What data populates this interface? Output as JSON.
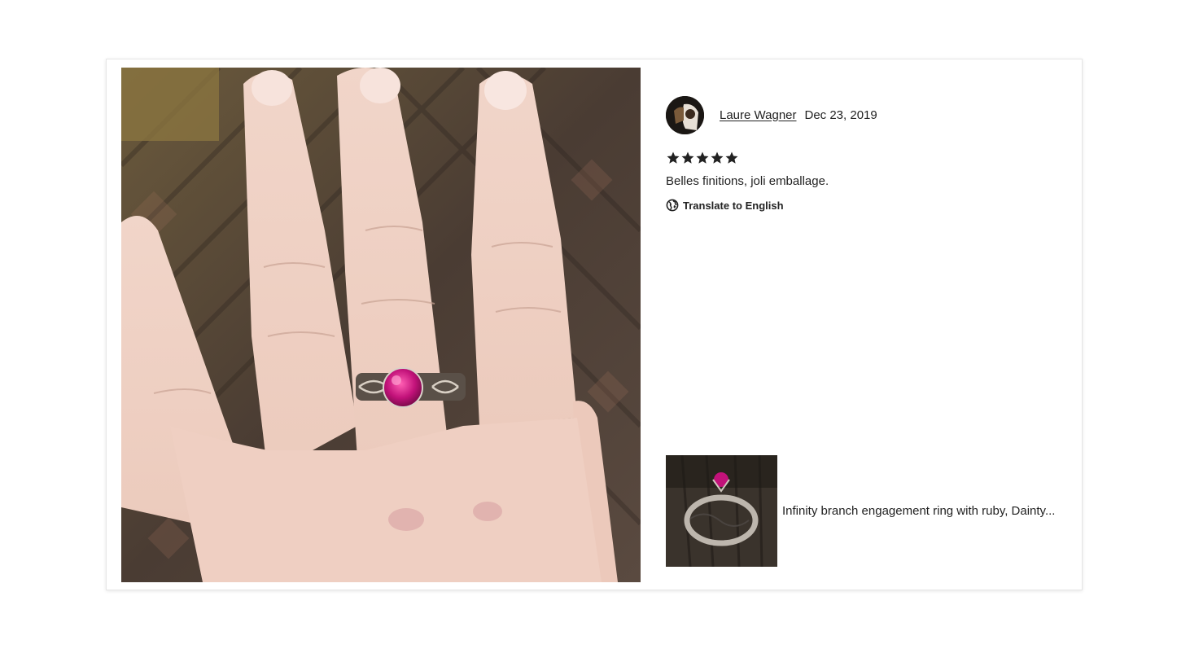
{
  "review": {
    "author_name": "Laure Wagner",
    "date": "Dec 23, 2019",
    "rating": 5,
    "rating_max": 5,
    "text": "Belles finitions, joli emballage.",
    "translate_label": "Translate to English"
  },
  "product": {
    "title": "Infinity branch engagement ring with ruby, Dainty..."
  },
  "icons": {
    "star": "star-icon",
    "globe": "globe-icon"
  },
  "colors": {
    "text": "#222222",
    "star": "#222222",
    "gem": "#c2127a",
    "card_border": "#e6e6e6"
  }
}
